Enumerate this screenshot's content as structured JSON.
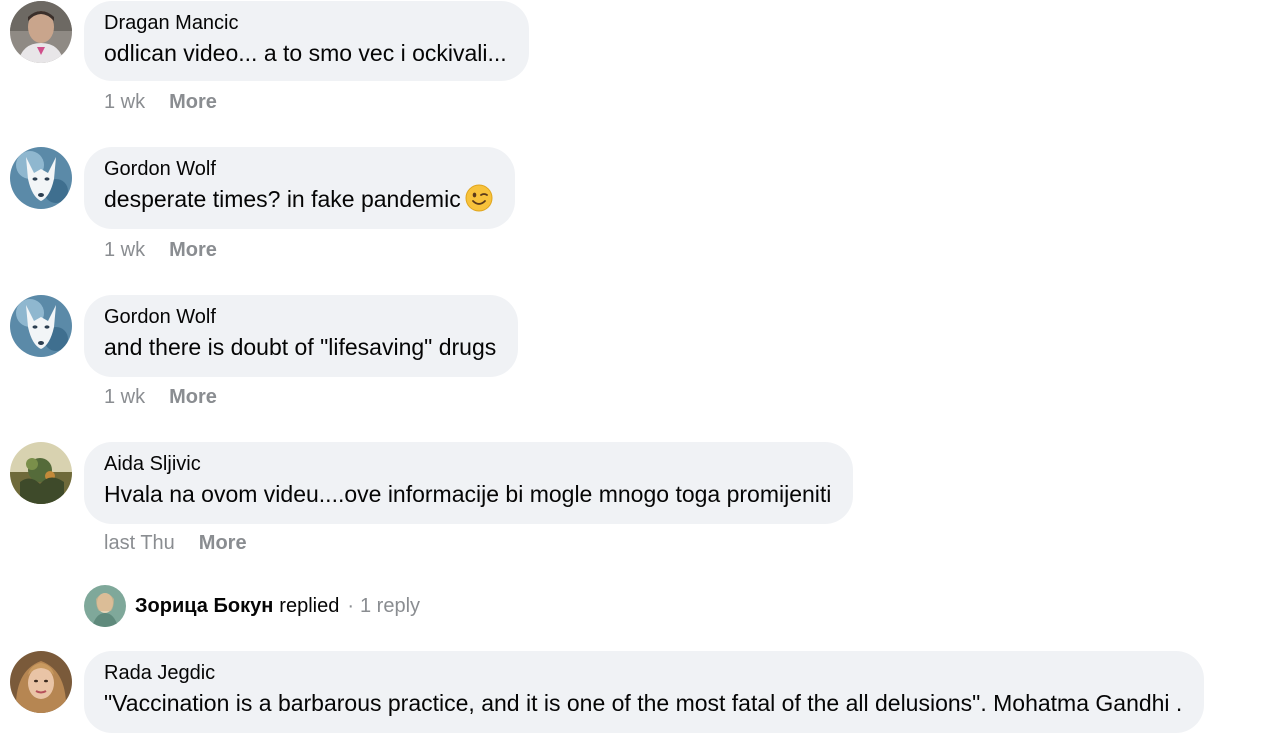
{
  "comments": [
    {
      "author": "Dragan Mancic",
      "text": "odlican video... a to smo vec i ockivali...",
      "time": "1 wk",
      "more": "More",
      "avatar": "man-photo"
    },
    {
      "author": "Gordon Wolf",
      "text": "desperate times? in fake pandemic",
      "emoji": "winking-face",
      "time": "1 wk",
      "more": "More",
      "avatar": "wolf-photo"
    },
    {
      "author": "Gordon Wolf",
      "text": "and there is doubt of \"lifesaving\" drugs",
      "time": "1 wk",
      "more": "More",
      "avatar": "wolf-photo"
    },
    {
      "author": "Aida Sljivic",
      "text": "Hvala na ovom videu....ove informacije bi mogle mnogo toga promijeniti",
      "time": "last Thu",
      "more": "More",
      "avatar": "nature-photo"
    },
    {
      "author": "Rada Jegdic",
      "text": "\"Vaccination is a barbarous practice, and it is one of the most fatal of the all delusions\". Mohatma Gandhi .",
      "avatar": "woman-photo"
    }
  ],
  "reply": {
    "name": "Зорица Бокун",
    "verb": "replied",
    "separator": "·",
    "count": "1 reply",
    "avatar": "illustration-photo"
  },
  "colors": {
    "bubble": "#f0f2f5",
    "meta": "#8a8d91",
    "text": "#050505"
  }
}
